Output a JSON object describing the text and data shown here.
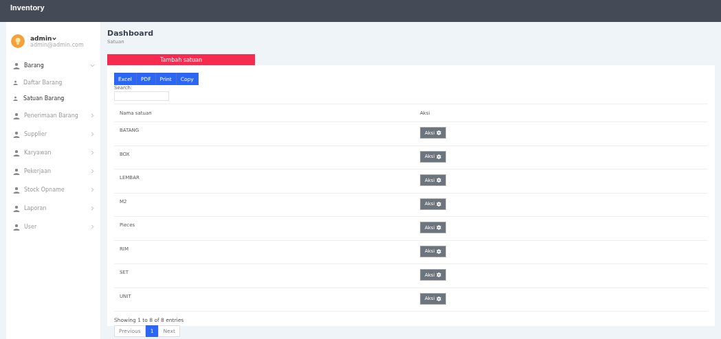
{
  "topbar": {
    "title": "Inventory"
  },
  "user": {
    "name": "admin",
    "email": "admin@admin.com"
  },
  "sidebar": {
    "items": [
      {
        "label": "Barang",
        "expanded": true,
        "selected": true,
        "children": [
          {
            "label": "Daftar Barang",
            "selected": false
          },
          {
            "label": "Satuan Barang",
            "selected": true
          }
        ]
      },
      {
        "label": "Penerimaan Barang",
        "expanded": false,
        "selected": false
      },
      {
        "label": "Supplier",
        "expanded": false,
        "selected": false
      },
      {
        "label": "Karyawan",
        "expanded": false,
        "selected": false
      },
      {
        "label": "Pekerjaan",
        "expanded": false,
        "selected": false
      },
      {
        "label": "Stock Opname",
        "expanded": false,
        "selected": false
      },
      {
        "label": "Laporan",
        "expanded": false,
        "selected": false
      },
      {
        "label": "User",
        "expanded": false,
        "selected": false
      }
    ]
  },
  "header": {
    "title": "Dashboard",
    "breadcrumb": "Satuan"
  },
  "add_button": "Tambah satuan",
  "export_buttons": [
    "Excel",
    "PDF",
    "Print",
    "Copy"
  ],
  "search": {
    "label": "Search:"
  },
  "table": {
    "columns": [
      "Nama satuan",
      "Aksi"
    ],
    "rows": [
      {
        "name": "BATANG",
        "action": "Aksi"
      },
      {
        "name": "BOX",
        "action": "Aksi"
      },
      {
        "name": "LEMBAR",
        "action": "Aksi"
      },
      {
        "name": "M2",
        "action": "Aksi"
      },
      {
        "name": "Pieces",
        "action": "Aksi"
      },
      {
        "name": "RIM",
        "action": "Aksi"
      },
      {
        "name": "SET",
        "action": "Aksi"
      },
      {
        "name": "UNIT",
        "action": "Aksi"
      }
    ]
  },
  "footer": {
    "info": "Showing 1 to 8 of 8 entries",
    "pages": [
      {
        "label": "Previous",
        "selected": false
      },
      {
        "label": "1",
        "selected": true
      },
      {
        "label": "Next",
        "selected": false
      }
    ]
  }
}
